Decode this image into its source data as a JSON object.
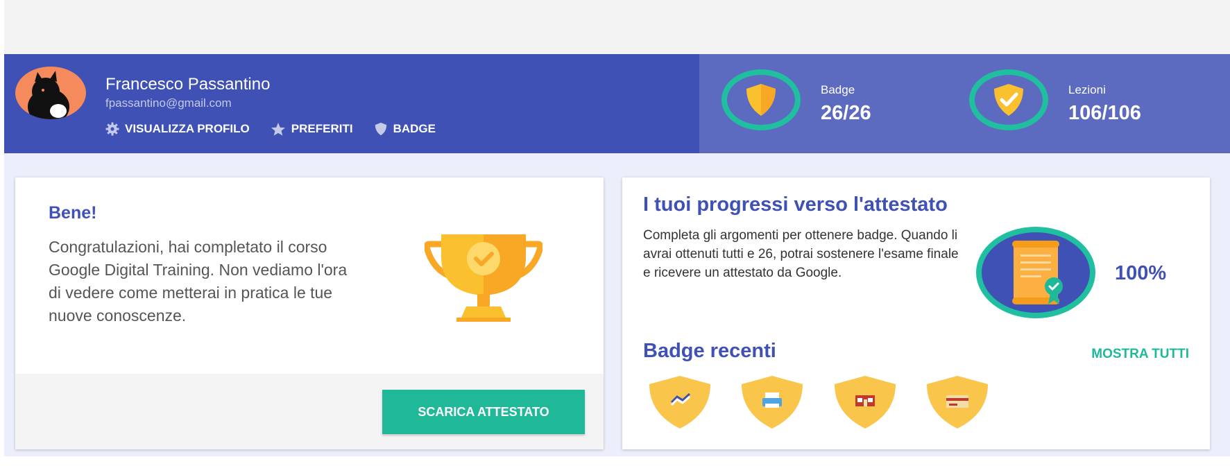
{
  "header": {
    "user_name": "Francesco Passantino",
    "user_email": "fpassantino@gmail.com",
    "links": [
      {
        "label": "VISUALIZZA PROFILO",
        "icon": "gear-icon"
      },
      {
        "label": "PREFERITI",
        "icon": "star-icon"
      },
      {
        "label": "BADGE",
        "icon": "shield-icon"
      }
    ],
    "stats": [
      {
        "label": "Badge",
        "value": "26/26",
        "icon": "shield-icon"
      },
      {
        "label": "Lezioni",
        "value": "106/106",
        "icon": "check-shield-icon"
      }
    ]
  },
  "congrats_card": {
    "title": "Bene!",
    "message": "Congratulazioni, hai completato il corso Google Digital Training. Non vediamo l'ora di vedere come metterai in pratica le tue nuove conoscenze.",
    "button_label": "SCARICA ATTESTATO",
    "icon": "trophy-icon"
  },
  "progress_card": {
    "title": "I tuoi progressi verso l'attestato",
    "description": "Completa gli argomenti per ottenere badge. Quando li avrai ottenuti tutti e 26, potrai sostenere l'esame finale e ricevere un attestato da Google.",
    "percent": "100%",
    "progress_fraction": 1.0,
    "icon": "certificate-icon",
    "recent_title": "Badge recenti",
    "show_all_label": "MOSTRA TUTTI",
    "recent_badges": [
      "chart-badge-icon",
      "printer-badge-icon",
      "store-badge-icon",
      "card-badge-icon"
    ]
  },
  "colors": {
    "primary": "#3f51b5",
    "primary_light": "#5c6bc0",
    "accent": "#1fb99a",
    "badge_yellow": "#f9c54a"
  }
}
